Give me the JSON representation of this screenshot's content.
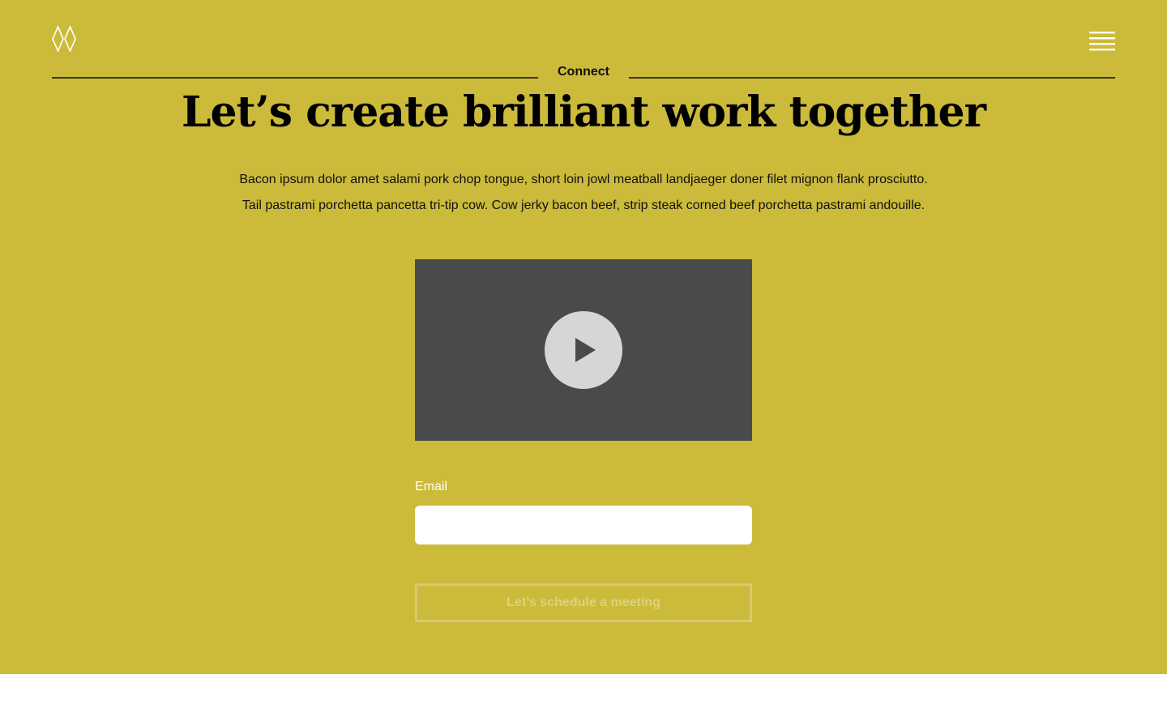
{
  "header": {
    "logo_icon": "diamond-logo-icon",
    "menu_icon": "hamburger-menu-icon"
  },
  "section": {
    "eyebrow": "Connect",
    "headline": "Let’s create brilliant work together",
    "lede_line1": "Bacon ipsum dolor amet salami pork chop tongue, short loin jowl meatball landjaeger doner filet mignon flank prosciutto.",
    "lede_line2": "Tail pastrami porchetta pancetta tri-tip cow. Cow jerky bacon beef, strip steak corned beef porchetta pastrami andouille."
  },
  "video": {
    "play_icon": "play-icon"
  },
  "form": {
    "email_label": "Email",
    "email_value": "",
    "email_placeholder": "",
    "submit_label": "Let’s schedule a meeting"
  },
  "colors": {
    "hero_background": "#ccba3b",
    "video_background": "#4a4a4a",
    "play_button": "#d6d6d6",
    "button_border": "#d6cb6e"
  }
}
